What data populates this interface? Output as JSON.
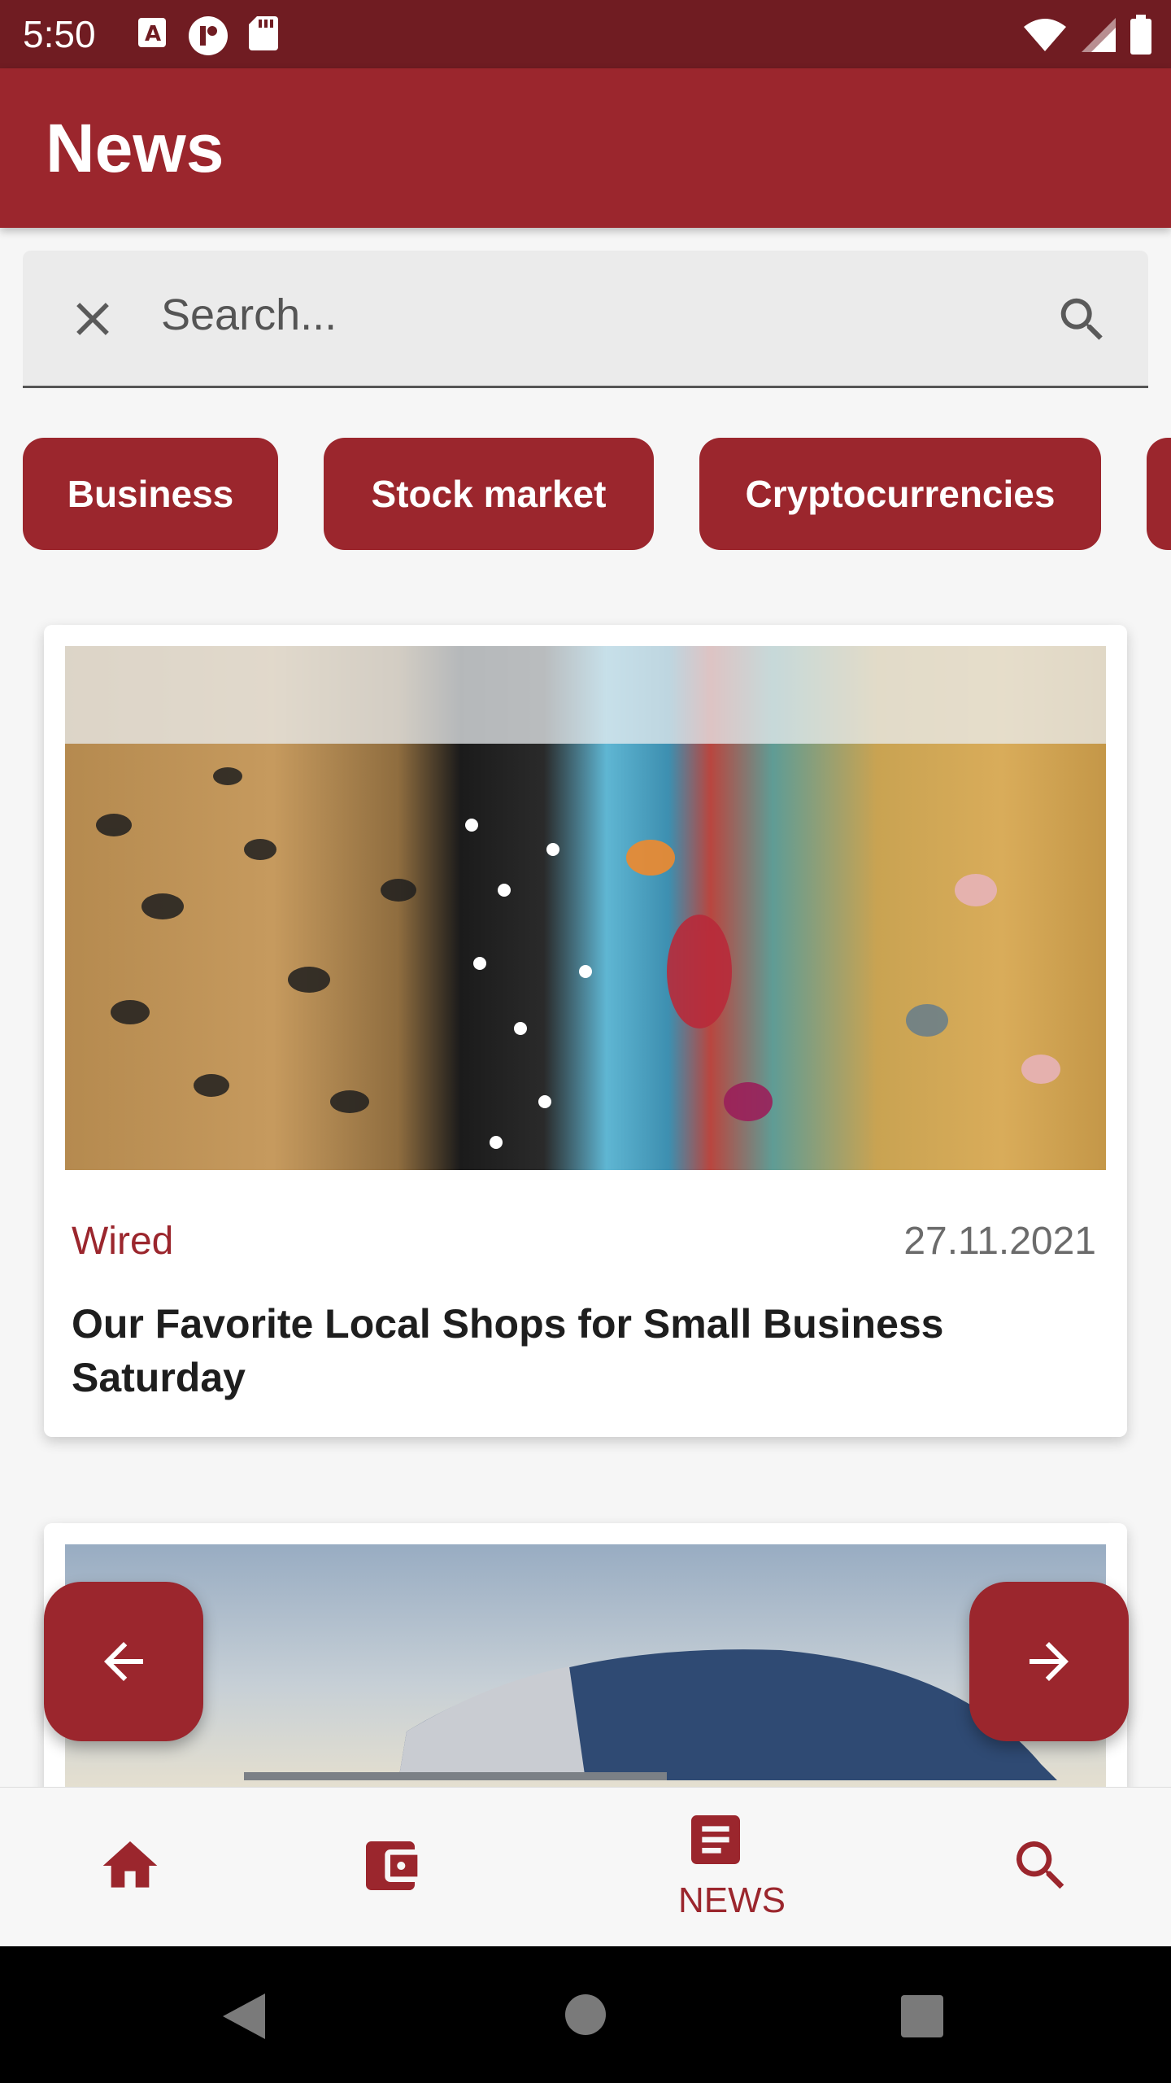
{
  "status_bar": {
    "time": "5:50"
  },
  "app_bar": {
    "title": "News"
  },
  "search": {
    "placeholder": "Search..."
  },
  "categories": [
    "Business",
    "Stock market",
    "Cryptocurrencies"
  ],
  "articles": [
    {
      "source": "Wired",
      "date": "27.11.2021",
      "title": "Our Favorite Local Shops for Small Business Saturday"
    }
  ],
  "bottom_nav": {
    "active_label": "NEWS"
  },
  "colors": {
    "primary": "#9b262d",
    "status_bar": "#701c22",
    "date_text": "#6b6b6b"
  },
  "icons": {
    "clear": "close-icon",
    "search": "search-icon",
    "prev": "arrow-left-icon",
    "next": "arrow-right-icon",
    "home": "home-icon",
    "wallet": "wallet-icon",
    "news": "article-icon",
    "nav_search": "search-icon"
  }
}
